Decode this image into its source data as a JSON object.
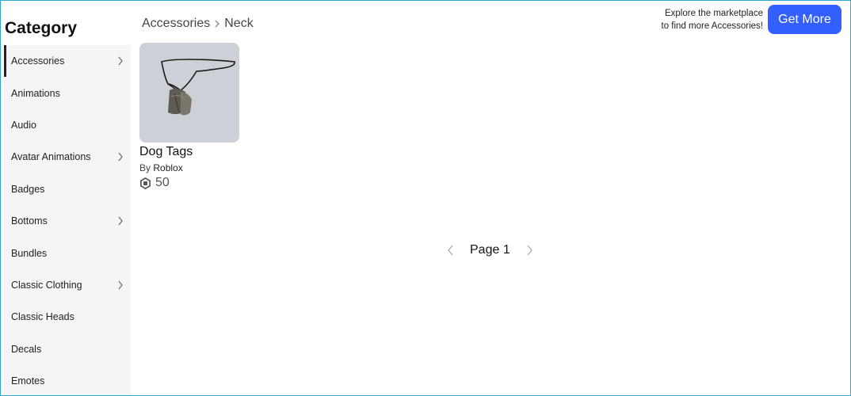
{
  "sidebar": {
    "title": "Category",
    "items": [
      {
        "label": "Accessories",
        "active": true,
        "has_submenu": true
      },
      {
        "label": "Animations",
        "active": false,
        "has_submenu": false
      },
      {
        "label": "Audio",
        "active": false,
        "has_submenu": false
      },
      {
        "label": "Avatar Animations",
        "active": false,
        "has_submenu": true
      },
      {
        "label": "Badges",
        "active": false,
        "has_submenu": false
      },
      {
        "label": "Bottoms",
        "active": false,
        "has_submenu": true
      },
      {
        "label": "Bundles",
        "active": false,
        "has_submenu": false
      },
      {
        "label": "Classic Clothing",
        "active": false,
        "has_submenu": true
      },
      {
        "label": "Classic Heads",
        "active": false,
        "has_submenu": false
      },
      {
        "label": "Decals",
        "active": false,
        "has_submenu": false
      },
      {
        "label": "Emotes",
        "active": false,
        "has_submenu": false
      }
    ]
  },
  "breadcrumb": {
    "parent": "Accessories",
    "current": "Neck",
    "separator_icon": "chevron-right-icon"
  },
  "promo": {
    "line1": "Explore the marketplace",
    "line2": "to find more Accessories!",
    "button_label": "Get More"
  },
  "items": [
    {
      "name": "Dog Tags",
      "by_label": "By",
      "creator": "Roblox",
      "price": "50",
      "currency_icon": "robux-icon"
    }
  ],
  "pagination": {
    "label": "Page 1",
    "prev_icon": "chevron-left-icon",
    "next_icon": "chevron-right-icon"
  },
  "colors": {
    "accent": "#335fff",
    "sidebar_bg": "#f5f5f5",
    "thumb_bg": "#cdd0d7",
    "frame_border": "#2aa7c9"
  }
}
